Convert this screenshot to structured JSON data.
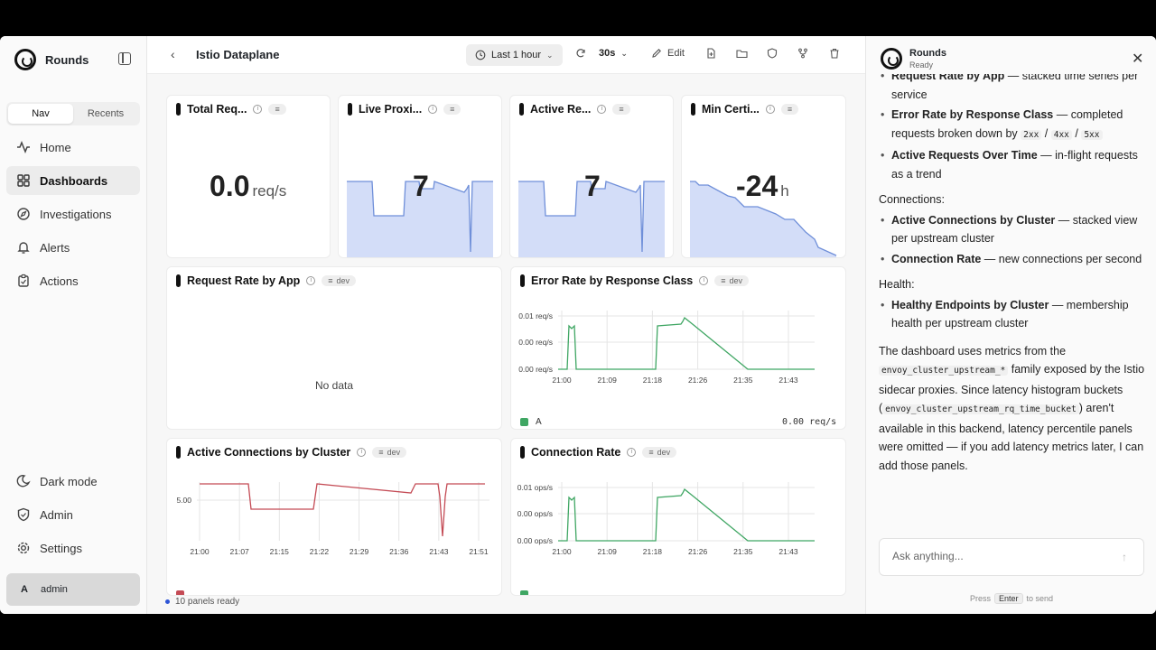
{
  "app": {
    "name": "Rounds"
  },
  "nav_tabs": {
    "nav": "Nav",
    "recents": "Recents"
  },
  "nav": [
    {
      "label": "Home",
      "icon": "activity-icon"
    },
    {
      "label": "Dashboards",
      "icon": "grid-icon"
    },
    {
      "label": "Investigations",
      "icon": "compass-icon"
    },
    {
      "label": "Alerts",
      "icon": "bell-icon"
    },
    {
      "label": "Actions",
      "icon": "clipboard-icon"
    }
  ],
  "bottom_nav": [
    {
      "label": "Dark mode",
      "icon": "moon-icon"
    },
    {
      "label": "Admin",
      "icon": "shield-icon"
    },
    {
      "label": "Settings",
      "icon": "gear-icon"
    }
  ],
  "user": {
    "initial": "A",
    "name": "admin"
  },
  "topbar": {
    "title": "Istio Dataplane",
    "time_range": "Last 1 hour",
    "refresh": "30s",
    "edit": "Edit"
  },
  "panels": {
    "total": {
      "title": "Total Req...",
      "value": "0.0",
      "unit": "req/s"
    },
    "live": {
      "title": "Live Proxi...",
      "value": "7"
    },
    "active": {
      "title": "Active Re...",
      "value": "7"
    },
    "cert": {
      "title": "Min Certi...",
      "value": "-24",
      "unit": "h"
    },
    "reqrate": {
      "title": "Request Rate by App",
      "tag": "dev",
      "nodata": "No data"
    },
    "errrate": {
      "title": "Error Rate by Response Class",
      "tag": "dev",
      "legend": "A",
      "legend_value": "0.00 req/s"
    },
    "conns": {
      "title": "Active Connections by Cluster",
      "tag": "dev"
    },
    "connrate": {
      "title": "Connection Rate",
      "tag": "dev"
    }
  },
  "chart_data": [
    {
      "type": "line",
      "title": "Error Rate by Response Class",
      "x": [
        "21:00",
        "21:09",
        "21:18",
        "21:26",
        "21:35",
        "21:43"
      ],
      "y_ticks": [
        "0.01 req/s",
        "0.00 req/s",
        "0.00 req/s"
      ],
      "series": [
        {
          "name": "A",
          "color": "#3fa663"
        }
      ]
    },
    {
      "type": "line",
      "title": "Active Connections by Cluster",
      "x": [
        "21:00",
        "21:07",
        "21:15",
        "21:22",
        "21:29",
        "21:36",
        "21:43",
        "21:51"
      ],
      "y_ticks": [
        "5.00"
      ],
      "series": [
        {
          "color": "#c44b55"
        }
      ]
    },
    {
      "type": "line",
      "title": "Connection Rate",
      "x": [
        "21:00",
        "21:09",
        "21:18",
        "21:26",
        "21:35",
        "21:43"
      ],
      "y_ticks": [
        "0.01 ops/s",
        "0.00 ops/s",
        "0.00 ops/s"
      ],
      "series": [
        {
          "color": "#3fa663"
        }
      ]
    }
  ],
  "status": "10 panels ready",
  "chat": {
    "name": "Rounds",
    "status": "Ready",
    "top_item": {
      "b": "Request Rate by App",
      "t": " — stacked time series per service"
    },
    "items1": [
      {
        "b": "Error Rate by Response Class",
        "t": " — completed requests broken down by "
      },
      {
        "b": "Active Requests Over Time",
        "t": " — in-flight requests as a trend"
      }
    ],
    "codes_status": [
      "2xx",
      "4xx",
      "5xx"
    ],
    "sec_conn": "Connections:",
    "items2": [
      {
        "b": "Active Connections by Cluster",
        "t": " — stacked view per upstream cluster"
      },
      {
        "b": "Connection Rate",
        "t": " — new connections per second"
      }
    ],
    "sec_health": "Health:",
    "items3": [
      {
        "b": "Healthy Endpoints by Cluster",
        "t": " — membership health per upstream cluster"
      }
    ],
    "para_a": "The dashboard uses metrics from the ",
    "code_a": "envoy_cluster_upstream_*",
    "para_b": " family exposed by the Istio sidecar proxies. Since latency histogram buckets (",
    "code_b": "envoy_cluster_upstream_rq_time_bucket",
    "para_c": ") aren't available in this backend, latency percentile panels were omitted — if you add latency metrics later, I can add those panels.",
    "input_placeholder": "Ask anything...",
    "hint_press": "Press",
    "hint_key": "Enter",
    "hint_tail": "to send"
  }
}
